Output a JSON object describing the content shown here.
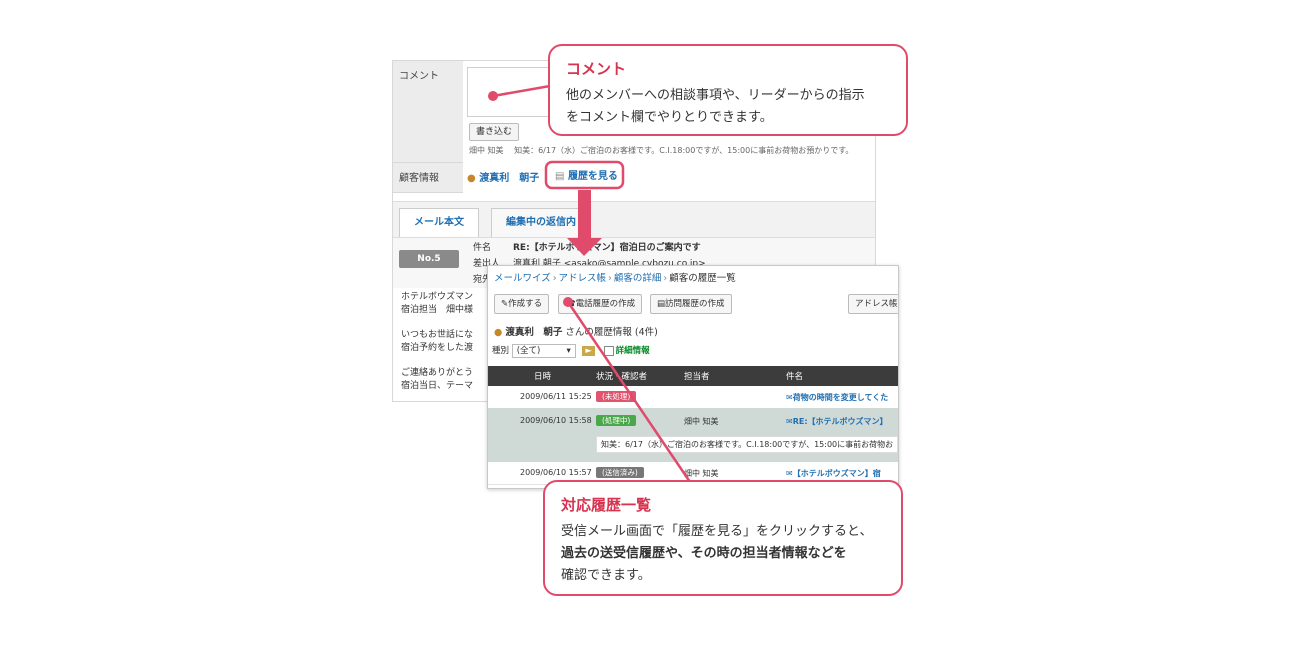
{
  "comment_panel": {
    "label": "コメント",
    "write_button": "書き込む",
    "log_author": "畑中 知美",
    "log_text": "知美：6/17（水）ご宿泊のお客様です。C.I.18:00ですが、15:00に事前お荷物お預かりです。"
  },
  "customer_info": {
    "label": "顧客情報",
    "name": "渡真利　朝子",
    "history_link": "履歴を見る"
  },
  "mail_tabs": [
    "メール本文",
    "編集中の返信内"
  ],
  "mail": {
    "no": "No.5",
    "subject_label": "件名",
    "subject": "RE:【ホテルボウズマン】宿泊日のご案内です",
    "from_label": "差出人",
    "from": "渡真利 朝子 <asako@sample.cybozu.co.jp>",
    "to_label": "宛先",
    "body": [
      "ホテルボウズマン\n宿泊担当　畑中様",
      "いつもお世話にな\n宿泊予約をした渡",
      "ご連絡ありがとう\n宿泊当日、テーマ"
    ]
  },
  "history_window": {
    "breadcrumb": [
      "メールワイズ",
      "アドレス帳",
      "顧客の詳細",
      "顧客の履歴一覧"
    ],
    "buttons": [
      "作成する",
      "電話履歴の作成",
      "訪問履歴の作成",
      "アドレス帳"
    ],
    "customer": "渡真利　朝子",
    "history_suffix": "さんの履歴情報 (4件)",
    "filter_label": "種別",
    "filter_value": "(全て)",
    "detail_label": "詳細情報",
    "columns": [
      "日時",
      "状況・確認者",
      "担当者",
      "件名"
    ],
    "rows": [
      {
        "datetime": "2009/06/11 15:25",
        "status": "(未処理)",
        "staff": "",
        "subject": "荷物の時間を変更してくた"
      },
      {
        "datetime": "2009/06/10 15:58",
        "status": "(処理中)",
        "staff": "畑中 知美",
        "subject": "RE:【ホテルボウズマン】"
      },
      {
        "datetime": "2009/06/10 15:57",
        "status": "(送信済み)",
        "staff": "畑中 知美",
        "subject": "【ホテルボウズマン】宿"
      }
    ],
    "note": "知美：6/17（水）ご宿泊のお客様です。C.I.18:00ですが、15:00に事前お荷物お"
  },
  "callouts": {
    "comment": {
      "title": "コメント",
      "line1": "他のメンバーへの相談事項や、リーダーからの指示",
      "line2": "をコメント欄でやりとりできます。"
    },
    "history": {
      "title": "対応履歴一覧",
      "line1": "受信メール画面で「履歴を見る」をクリックすると、",
      "line2": "過去の送受信履歴や、その時の担当者情報などを",
      "line3": "確認できます。"
    }
  },
  "colors": {
    "accent": "#e04b6b",
    "link": "#1f6fb2",
    "status_unprocessed": "#e0546e",
    "status_processing": "#4aa74a",
    "status_sent": "#777777"
  }
}
